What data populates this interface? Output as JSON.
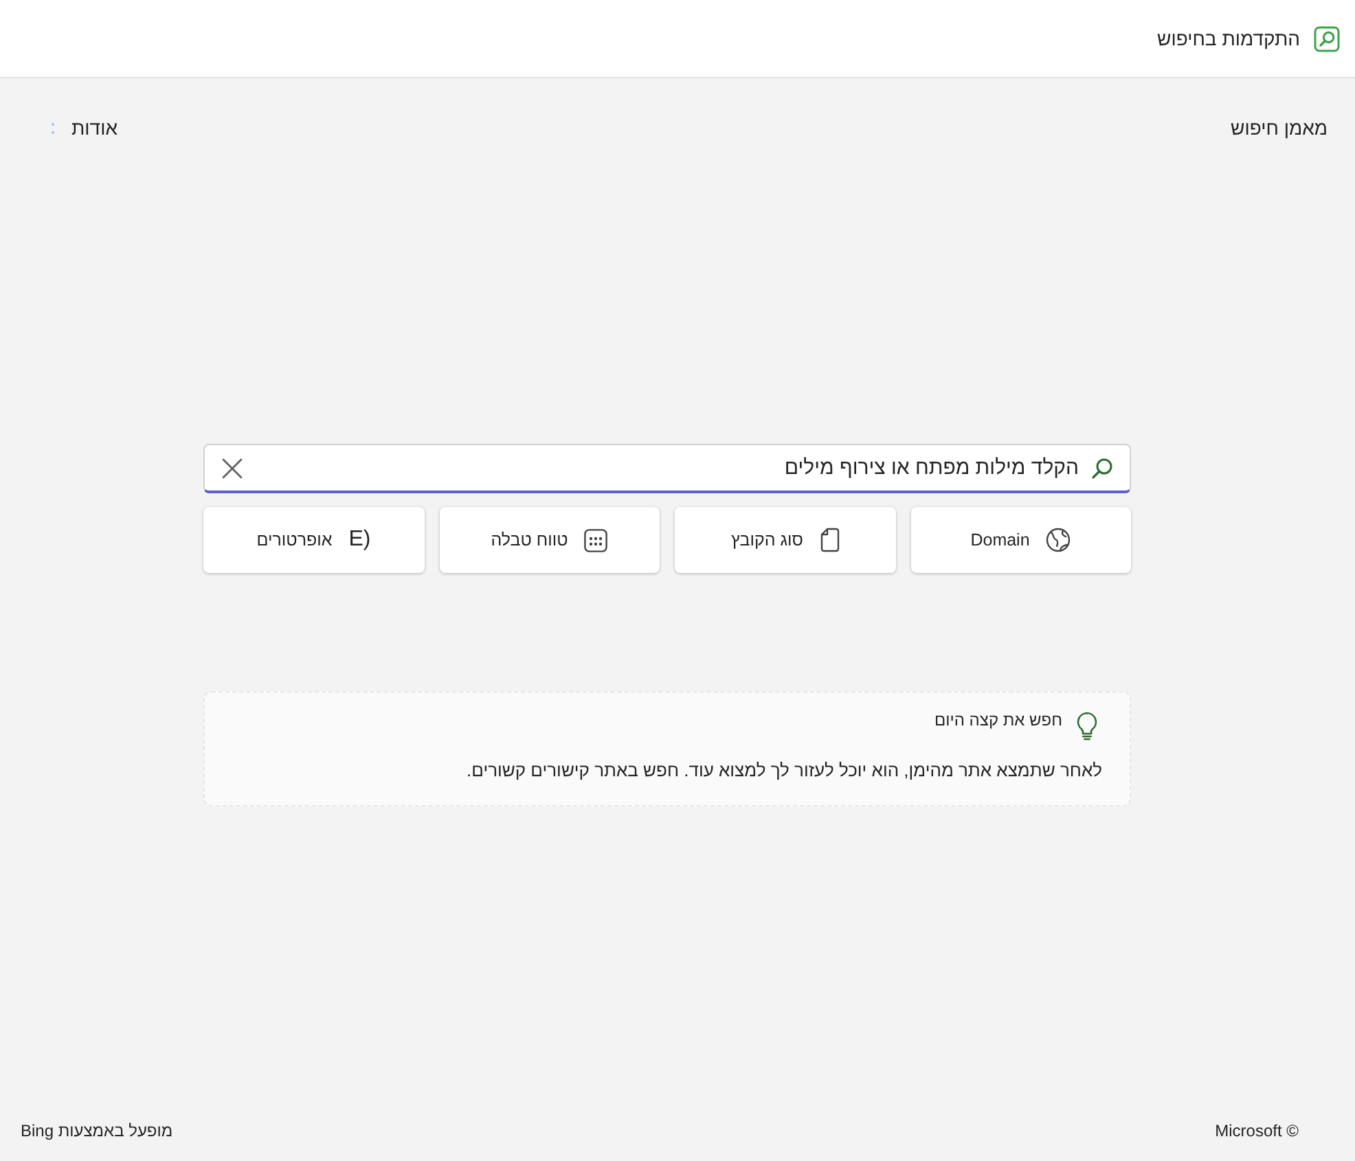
{
  "header": {
    "title": "התקדמות בחיפוש"
  },
  "nav": {
    "coach": "מאמן חיפוש",
    "about": "אודות"
  },
  "search": {
    "value": "הקלד מילות מפתח או צירוף מילים"
  },
  "filters": [
    {
      "kind": "domain",
      "label": "Domain"
    },
    {
      "kind": "file_type",
      "label": "סוג הקובץ"
    },
    {
      "kind": "table_range",
      "label": "טווח טבלה"
    },
    {
      "kind": "operators",
      "glyph": "E)",
      "label": "אופרטורים"
    }
  ],
  "tip": {
    "title": "חפש את קצה היום",
    "text": "לאחר שתמצא אתר מהימן, הוא יוכל לעזור לך למצוא עוד. חפש באתר קישורים קשורים."
  },
  "footer": {
    "copyright": "© Microsoft",
    "powered_by": "מופעל באמצעות Bing"
  }
}
